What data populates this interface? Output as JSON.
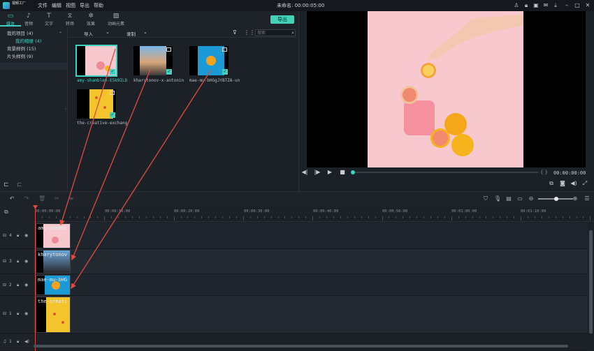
{
  "app": {
    "logo_text": "视频工厂",
    "menu": [
      "文件",
      "编辑",
      "视图",
      "导出",
      "帮助"
    ],
    "doc_title": "未命名: 00:00:05:00"
  },
  "tabs": [
    {
      "label": "媒体",
      "icon": "folder-icon",
      "active": true
    },
    {
      "label": "音频",
      "icon": "music-note-icon",
      "active": false
    },
    {
      "label": "文字",
      "icon": "text-icon",
      "active": false
    },
    {
      "label": "转场",
      "icon": "transition-icon",
      "active": false
    },
    {
      "label": "效果",
      "icon": "effects-icon",
      "active": false
    },
    {
      "label": "动画元素",
      "icon": "image-element-icon",
      "active": false
    }
  ],
  "export_label": "导出",
  "tree": {
    "items": [
      "我的项目 (4)",
      "我的相册 (4)",
      "背景样例 (15)",
      "片头样例 (9)"
    ]
  },
  "media_header": {
    "import_label": "导入",
    "record_label": "录制",
    "search_placeholder": "搜索"
  },
  "media": [
    {
      "caption": "amy-shamblen-E5k9ILDZ6F",
      "selected": true,
      "bg": "#f7c9cf"
    },
    {
      "caption": "kharytonov-x-antonina-PC",
      "selected": false,
      "bg": "#1d3a5c"
    },
    {
      "caption": "mae-mu-bHGgJYBTZA-unsp",
      "selected": false,
      "bg": "#1b9ad6"
    },
    {
      "caption": "the-creative-exchange-s",
      "selected": false,
      "bg": "#f3c42b"
    }
  ],
  "preview": {
    "time": "00:00:00:00",
    "brackets": "{ }"
  },
  "ruler": {
    "labels": [
      "00:00:00:00",
      "00:00:10:00",
      "00:00:20:00",
      "00:00:30:00",
      "00:00:40:00",
      "00:00:50:00",
      "00:01:00:00",
      "00:01:10:00"
    ]
  },
  "tracks": [
    {
      "label": "4",
      "clip": "amy-shambl"
    },
    {
      "label": "3",
      "clip": "kharytonov"
    },
    {
      "label": "2",
      "clip": "mae-mu-bHG"
    },
    {
      "label": "1",
      "clip": "the-creati"
    }
  ],
  "audio_track": {
    "label": "1"
  },
  "colors": {
    "accent": "#3fd1c1",
    "export": "#43d1b7",
    "playhead": "#e04a3f",
    "arrow": "#e04a3f"
  }
}
